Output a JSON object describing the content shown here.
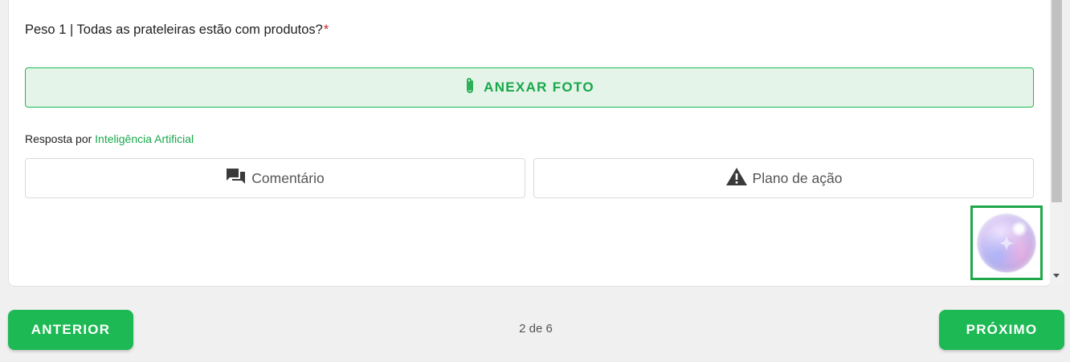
{
  "question": {
    "text": "Peso 1 | Todas as prateleiras estão com produtos?",
    "required_mark": "*"
  },
  "attach_button": {
    "label": "ANEXAR FOTO",
    "icon": "paperclip-icon"
  },
  "ai_answer": {
    "prefix": "Resposta por ",
    "link": "Inteligência Artificial"
  },
  "options": {
    "comment": {
      "label": "Comentário",
      "icon": "chat-icon"
    },
    "action_plan": {
      "label": "Plano de ação",
      "icon": "warning-icon"
    }
  },
  "ai_assistant": {
    "icon": "sparkle-bubble-icon"
  },
  "navigation": {
    "prev_label": "ANTERIOR",
    "next_label": "PRÓXIMO",
    "page_indicator": "2 de 6"
  },
  "colors": {
    "accent": "#1db954",
    "accent_text": "#17a84a",
    "attach_bg": "#e4f4e8",
    "required": "#c62828",
    "highlight_border": "#1fa84a"
  }
}
